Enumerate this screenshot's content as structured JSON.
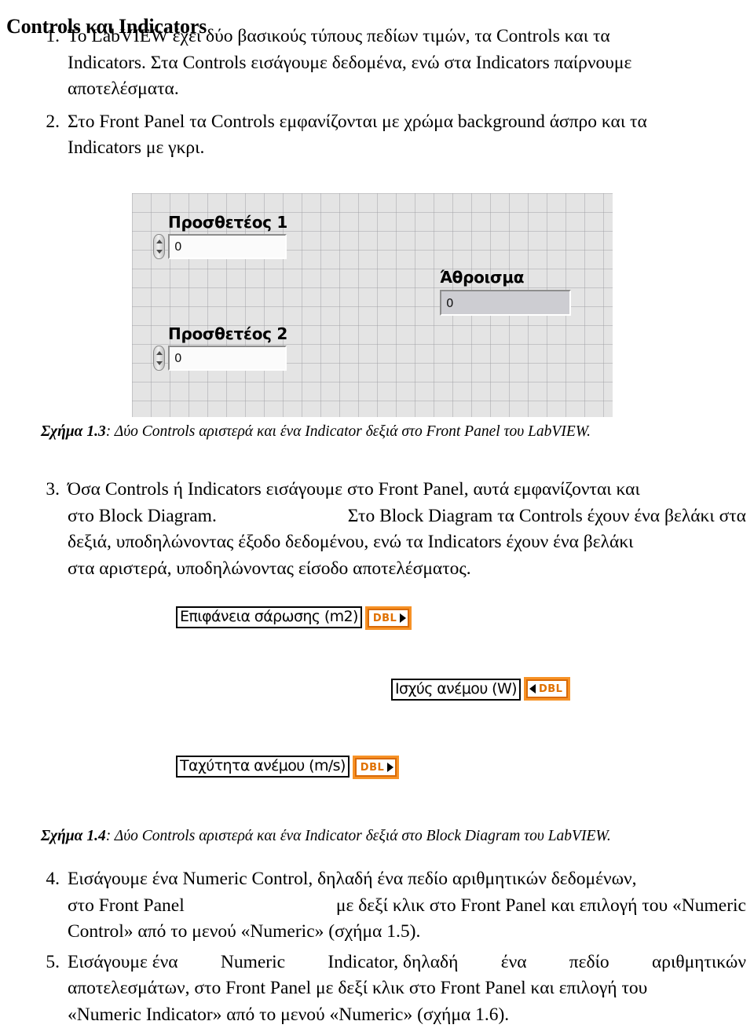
{
  "document": {
    "title": "Controls και Indicators"
  },
  "list": [
    {
      "num": "1.",
      "lines": [
        [
          "Το LabVIEW έχει δύο βασικούς τύπους πεδίων τιμών, τα Controls και τα"
        ],
        [
          "Indicators. Στα Controls εισάγουμε δεδομένα, ενώ στα Indicators παίρνουμε"
        ],
        [
          "αποτελέσματα."
        ]
      ]
    },
    {
      "num": "2.",
      "lines": [
        [
          "Στο Front Panel τα Controls εμφανίζονται με χρώμα background άσπρο και τα"
        ],
        [
          "Indicators με γκρι."
        ]
      ]
    },
    {
      "num": "3.",
      "lines": [
        [
          "Όσα Controls ή Indicators εισάγουμε στο Front Panel, αυτά εμφανίζονται και"
        ],
        [
          "στο Block Diagram.",
          "Στο Block Diagram τα Controls έχουν ένα βελάκι στα"
        ],
        [
          "δεξιά, υποδηλώνοντας έξοδο δεδομένου, ενώ τα Indicators έχουν ένα βελάκι"
        ],
        [
          "στα αριστερά, υποδηλώνοντας είσοδο αποτελέσματος."
        ]
      ]
    },
    {
      "num": "4.",
      "lines": [
        [
          "Εισάγουμε ένα Numeric Control, δηλαδή ένα πεδίο αριθμητικών δεδομένων,"
        ],
        [
          "στο Front Panel",
          "με δεξί κλικ στο Front Panel και επιλογή του «Numeric"
        ],
        [
          "Control» από το μενού «Numeric» (σχήμα 1.5)."
        ]
      ]
    },
    {
      "num": "5.",
      "lines": [
        [
          "Εισάγουμε ένα",
          "Numeric",
          "Indicator, δηλαδή",
          "ένα",
          "πεδίο",
          "αριθμητικών"
        ],
        [
          "αποτελεσμάτων, στο Front Panel με δεξί κλικ στο Front Panel και επιλογή του"
        ],
        [
          "«Numeric Indicator» από το μενού «Numeric» (σχήμα 1.6)."
        ]
      ]
    }
  ],
  "figures": {
    "front_panel": {
      "caption_label": "Σχήμα 1.3",
      "caption_text": ": Δύο Controls αριστερά και ένα Indicator δεξιά στο Front Panel του LabVIEW.",
      "controls": [
        {
          "label": "Προσθετέος 1",
          "value": "0",
          "kind": "control"
        },
        {
          "label": "Προσθετέος 2",
          "value": "0",
          "kind": "control"
        },
        {
          "label": "Άθροισμα",
          "value": "0",
          "kind": "indicator"
        }
      ]
    },
    "block_diagram": {
      "caption_label": "Σχήμα 1.4",
      "caption_text": ": Δύο Controls αριστερά και ένα Indicator δεξιά στο Block Diagram του LabVIEW.",
      "terminals": [
        {
          "label": "Επιφάνεια σάρωσης (m2)",
          "datatype": "DBL",
          "arrow": "right"
        },
        {
          "label": "Ισχύς ανέμου (W)",
          "datatype": "DBL",
          "arrow": "left"
        },
        {
          "label": "Ταχύτητα ανέμου (m/s)",
          "datatype": "DBL",
          "arrow": "right"
        }
      ]
    }
  },
  "colors": {
    "page_background": "#ffffff",
    "text": "#000000",
    "panel_grid_background": "#e4e4e4",
    "control_field_background": "#fbfbfb",
    "indicator_field_background": "#cdcdd2",
    "terminal_orange": "#f79226",
    "terminal_border": "#d96a07",
    "terminal_text": "#e07000"
  }
}
